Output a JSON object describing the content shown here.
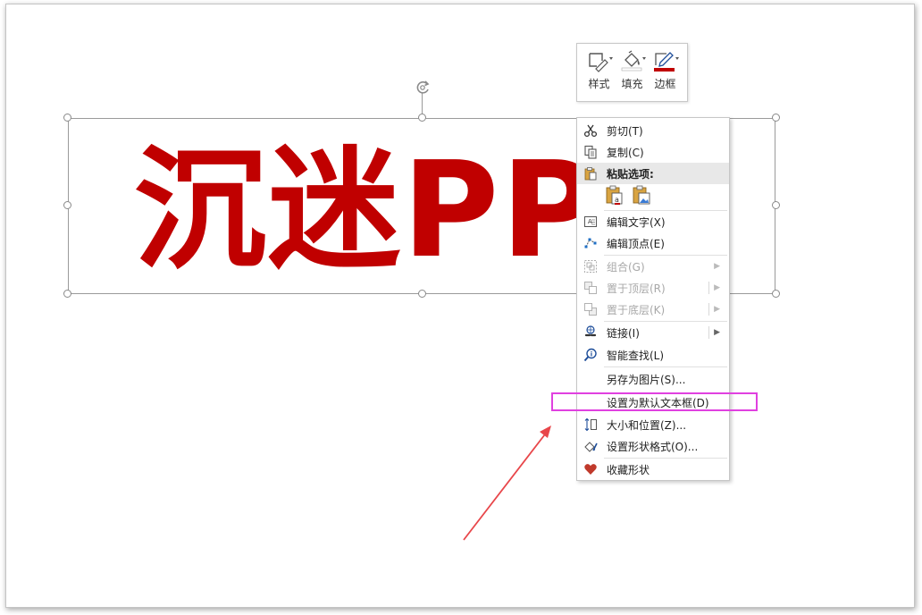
{
  "slide": {
    "title_text": "沉迷PP"
  },
  "mini_toolbar": {
    "style_label": "样式",
    "fill_label": "填充",
    "border_label": "边框"
  },
  "colors": {
    "accent_red": "#c00000",
    "highlight_magenta": "#e040e0",
    "arrow_red": "#e8464a"
  },
  "context_menu": {
    "cut": "剪切(T)",
    "copy": "复制(C)",
    "paste_options": "粘贴选项:",
    "edit_text": "编辑文字(X)",
    "edit_points": "编辑顶点(E)",
    "group": "组合(G)",
    "bring_to_front": "置于顶层(R)",
    "send_to_back": "置于底层(K)",
    "link": "链接(I)",
    "smart_lookup": "智能查找(L)",
    "save_as_picture": "另存为图片(S)...",
    "set_default_textbox": "设置为默认文本框(D)",
    "size_position": "大小和位置(Z)...",
    "format_shape": "设置形状格式(O)...",
    "favorite_shape": "收藏形状"
  },
  "icons": {
    "cut": "scissors-icon",
    "copy": "copy-icon",
    "paste": "paste-icon",
    "edit_text": "edit-text-icon",
    "edit_points": "edit-points-icon",
    "group": "group-icon",
    "bring_front": "bring-front-icon",
    "send_back": "send-back-icon",
    "link": "link-icon",
    "smart_lookup": "smart-lookup-icon",
    "size_position": "size-position-icon",
    "format_shape": "format-shape-icon",
    "favorite": "heart-icon"
  }
}
